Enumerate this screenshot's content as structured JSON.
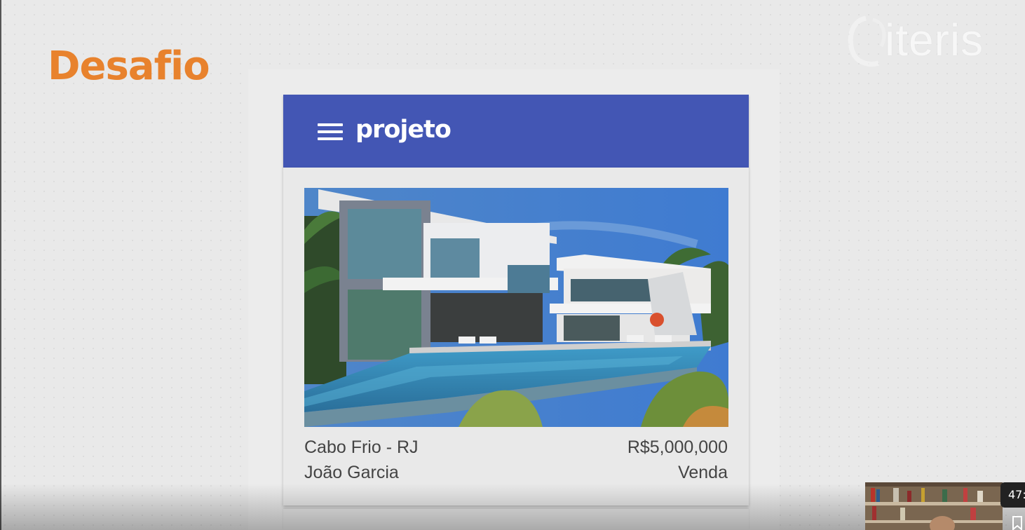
{
  "slide": {
    "title": "Desafio"
  },
  "logo": {
    "text": "iteris",
    "subtitle": ""
  },
  "app": {
    "title": "projeto",
    "primary_color": "#4356b4",
    "menu_icon": "hamburger-menu-icon"
  },
  "listing": {
    "image": "modern-house-with-pool-photo",
    "location": "Cabo Frio - RJ",
    "owner": "João Garcia",
    "price": "R$5,000,000",
    "type": "Venda"
  },
  "video": {
    "timestamp": "47:",
    "bookmark_icon": "bookmark-icon"
  },
  "colors": {
    "title_orange": "#e8822d",
    "background": "#e9e9e9"
  }
}
